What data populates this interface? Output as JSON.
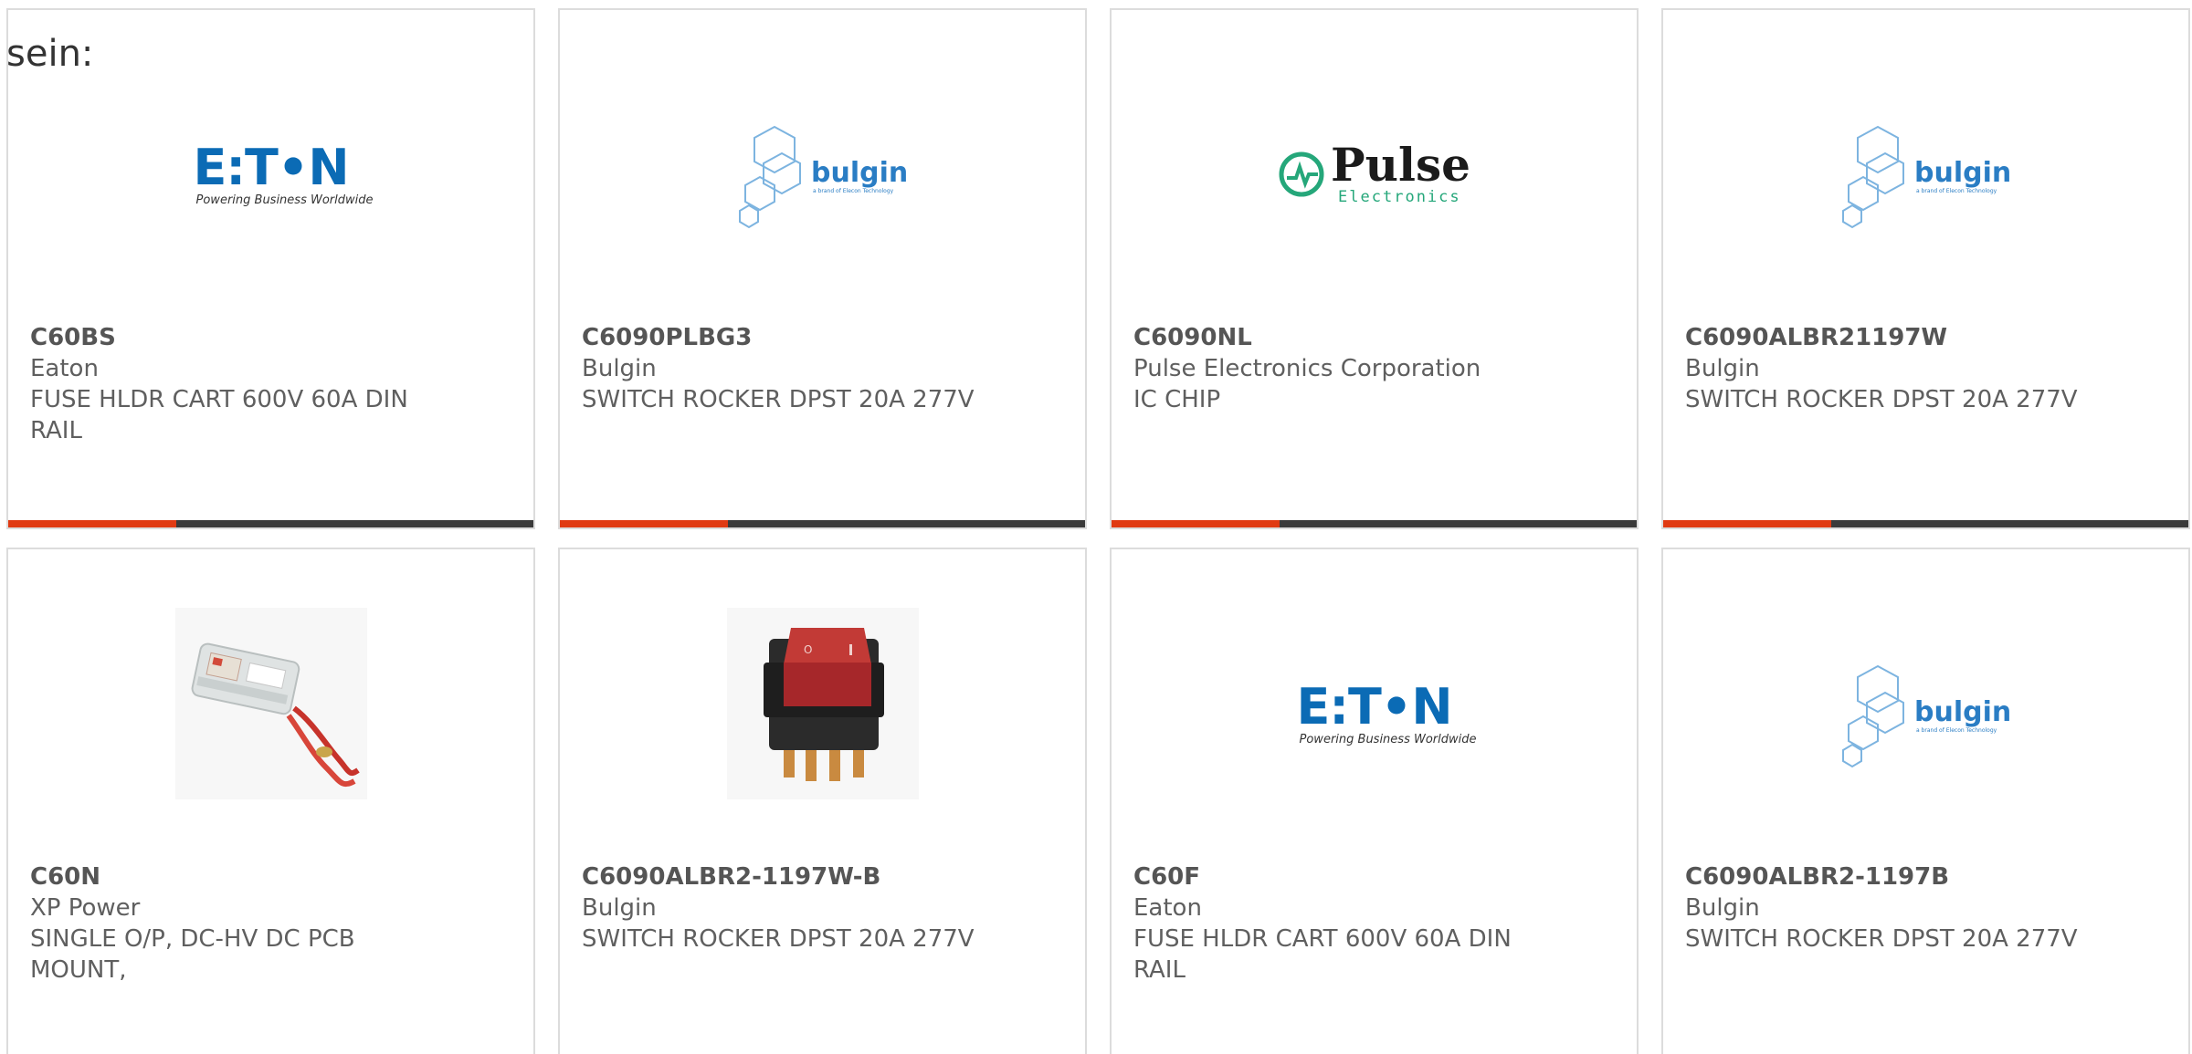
{
  "intro_text": "sein:",
  "colors": {
    "accent_bar": "#e03a12",
    "dark_bar": "#3a3a3a",
    "eaton_blue": "#0b6bb5",
    "bulgin_blue": "#2a7dc4",
    "pulse_green": "#25a77a"
  },
  "products": [
    {
      "part_number": "C60BS",
      "manufacturer": "Eaton",
      "description": "FUSE HLDR CART 600V 60A DIN RAIL",
      "image": "eaton-logo",
      "logo_word": "E:T•N",
      "logo_tagline": "Powering Business Worldwide"
    },
    {
      "part_number": "C6090PLBG3",
      "manufacturer": "Bulgin",
      "description": "SWITCH ROCKER DPST 20A 277V",
      "image": "bulgin-logo",
      "logo_word": "bulgin",
      "logo_tagline": "a brand of Elecon Technology"
    },
    {
      "part_number": "C6090NL",
      "manufacturer": "Pulse Electronics Corporation",
      "description": "IC CHIP",
      "image": "pulse-logo",
      "logo_word": "Pulse",
      "logo_tagline": "Electronics"
    },
    {
      "part_number": "C6090ALBR21197W",
      "manufacturer": "Bulgin",
      "description": "SWITCH ROCKER DPST 20A 277V",
      "image": "bulgin-logo",
      "logo_word": "bulgin",
      "logo_tagline": "a brand of Elecon Technology"
    },
    {
      "part_number": "C60N",
      "manufacturer": "XP Power",
      "description": "SINGLE O/P, DC-HV DC PCB MOUNT,",
      "image": "power-module-photo"
    },
    {
      "part_number": "C6090ALBR2-1197W-B",
      "manufacturer": "Bulgin",
      "description": "SWITCH ROCKER DPST 20A 277V",
      "image": "rocker-switch-photo"
    },
    {
      "part_number": "C60F",
      "manufacturer": "Eaton",
      "description": "FUSE HLDR CART 600V 60A DIN RAIL",
      "image": "eaton-logo",
      "logo_word": "E:T•N",
      "logo_tagline": "Powering Business Worldwide"
    },
    {
      "part_number": "C6090ALBR2-1197B",
      "manufacturer": "Bulgin",
      "description": "SWITCH ROCKER DPST 20A 277V",
      "image": "bulgin-logo",
      "logo_word": "bulgin",
      "logo_tagline": "a brand of Elecon Technology"
    }
  ]
}
